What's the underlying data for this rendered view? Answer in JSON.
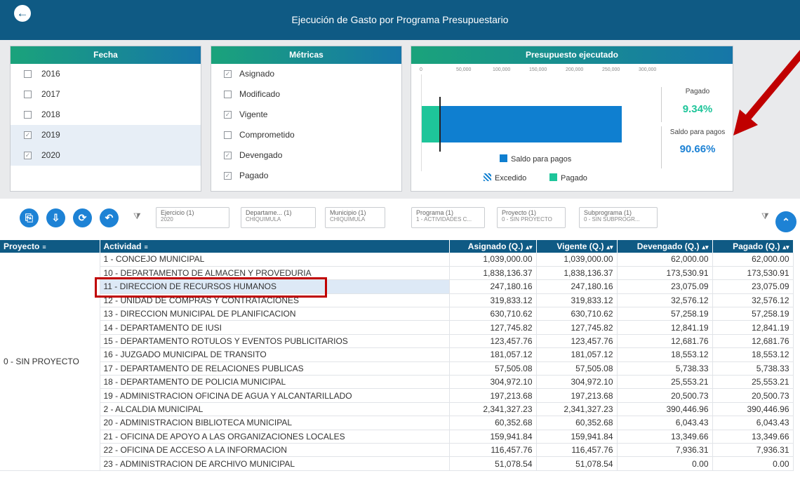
{
  "header": {
    "title": "Ejecución de Gasto por Programa Presupuestario"
  },
  "fecha": {
    "title": "Fecha",
    "items": [
      {
        "label": "2016",
        "checked": false
      },
      {
        "label": "2017",
        "checked": false
      },
      {
        "label": "2018",
        "checked": false
      },
      {
        "label": "2019",
        "checked": true
      },
      {
        "label": "2020",
        "checked": true
      }
    ]
  },
  "metricas": {
    "title": "Métricas",
    "items": [
      {
        "label": "Asignado",
        "checked": true
      },
      {
        "label": "Modificado",
        "checked": false
      },
      {
        "label": "Vigente",
        "checked": true
      },
      {
        "label": "Comprometido",
        "checked": false
      },
      {
        "label": "Devengado",
        "checked": true
      },
      {
        "label": "Pagado",
        "checked": true
      }
    ]
  },
  "presupuesto": {
    "title": "Presupuesto ejecutado",
    "axis_ticks": [
      "0",
      "50,000",
      "100,000",
      "150,000",
      "200,000",
      "250,000",
      "300,000"
    ],
    "pagado_label": "Pagado",
    "pagado_value": "9.34%",
    "saldo_label": "Saldo para pagos",
    "saldo_value": "90.66%",
    "legend_saldo": "Saldo para pagos",
    "legend_excedido": "Excedido",
    "legend_pagado": "Pagado",
    "colors": {
      "pagado": "#1ec59a",
      "saldo": "#0f7fd0"
    }
  },
  "toolbar": {
    "chips": [
      {
        "title": "Ejercicio (1)",
        "value": "2020"
      },
      {
        "title": "Departame... (1)",
        "value": "CHIQUIMULA"
      },
      {
        "title": "Municipio (1)",
        "value": "CHIQUIMULA"
      },
      {
        "title": "Programa (1)",
        "value": "1 - ACTIVIDADES C..."
      },
      {
        "title": "Proyecto (1)",
        "value": "0 - SIN PROYECTO"
      },
      {
        "title": "Subprograma (1)",
        "value": "0 - SIN SUBPROGR..."
      }
    ]
  },
  "table": {
    "headers": [
      "Proyecto",
      "Actividad",
      "Asignado (Q.)",
      "Vigente (Q.)",
      "Devengado (Q.)",
      "Pagado (Q.)"
    ],
    "proyecto": "0 - SIN PROYECTO",
    "rows": [
      [
        "1 - CONCEJO MUNICIPAL",
        "1,039,000.00",
        "1,039,000.00",
        "62,000.00",
        "62,000.00"
      ],
      [
        "10 - DEPARTAMENTO DE ALMACEN Y PROVEDURIA",
        "1,838,136.37",
        "1,838,136.37",
        "173,530.91",
        "173,530.91"
      ],
      [
        "11 - DIRECCION DE RECURSOS HUMANOS",
        "247,180.16",
        "247,180.16",
        "23,075.09",
        "23,075.09"
      ],
      [
        "12 - UNIDAD DE COMPRAS Y CONTRATACIONES",
        "319,833.12",
        "319,833.12",
        "32,576.12",
        "32,576.12"
      ],
      [
        "13 - DIRECCION MUNICIPAL DE PLANIFICACION",
        "630,710.62",
        "630,710.62",
        "57,258.19",
        "57,258.19"
      ],
      [
        "14 - DEPARTAMENTO DE IUSI",
        "127,745.82",
        "127,745.82",
        "12,841.19",
        "12,841.19"
      ],
      [
        "15 - DEPARTAMENTO ROTULOS Y EVENTOS PUBLICITARIOS",
        "123,457.76",
        "123,457.76",
        "12,681.76",
        "12,681.76"
      ],
      [
        "16 - JUZGADO MUNICIPAL DE TRANSITO",
        "181,057.12",
        "181,057.12",
        "18,553.12",
        "18,553.12"
      ],
      [
        "17 - DEPARTAMENTO DE RELACIONES PUBLICAS",
        "57,505.08",
        "57,505.08",
        "5,738.33",
        "5,738.33"
      ],
      [
        "18 - DEPARTAMENTO DE POLICIA MUNICIPAL",
        "304,972.10",
        "304,972.10",
        "25,553.21",
        "25,553.21"
      ],
      [
        "19 - ADMINISTRACION OFICINA DE AGUA Y ALCANTARILLADO",
        "197,213.68",
        "197,213.68",
        "20,500.73",
        "20,500.73"
      ],
      [
        "2 - ALCALDIA MUNICIPAL",
        "2,341,327.23",
        "2,341,327.23",
        "390,446.96",
        "390,446.96"
      ],
      [
        "20 - ADMINISTRACION BIBLIOTECA MUNICIPAL",
        "60,352.68",
        "60,352.68",
        "6,043.43",
        "6,043.43"
      ],
      [
        "21 - OFICINA DE APOYO A LAS ORGANIZACIONES LOCALES",
        "159,941.84",
        "159,941.84",
        "13,349.66",
        "13,349.66"
      ],
      [
        "22 - OFICINA DE ACCESO A LA INFORMACION",
        "116,457.76",
        "116,457.76",
        "7,936.31",
        "7,936.31"
      ],
      [
        "23 - ADMINISTRACION DE ARCHIVO MUNICIPAL",
        "51,078.54",
        "51,078.54",
        "0.00",
        "0.00"
      ]
    ]
  }
}
